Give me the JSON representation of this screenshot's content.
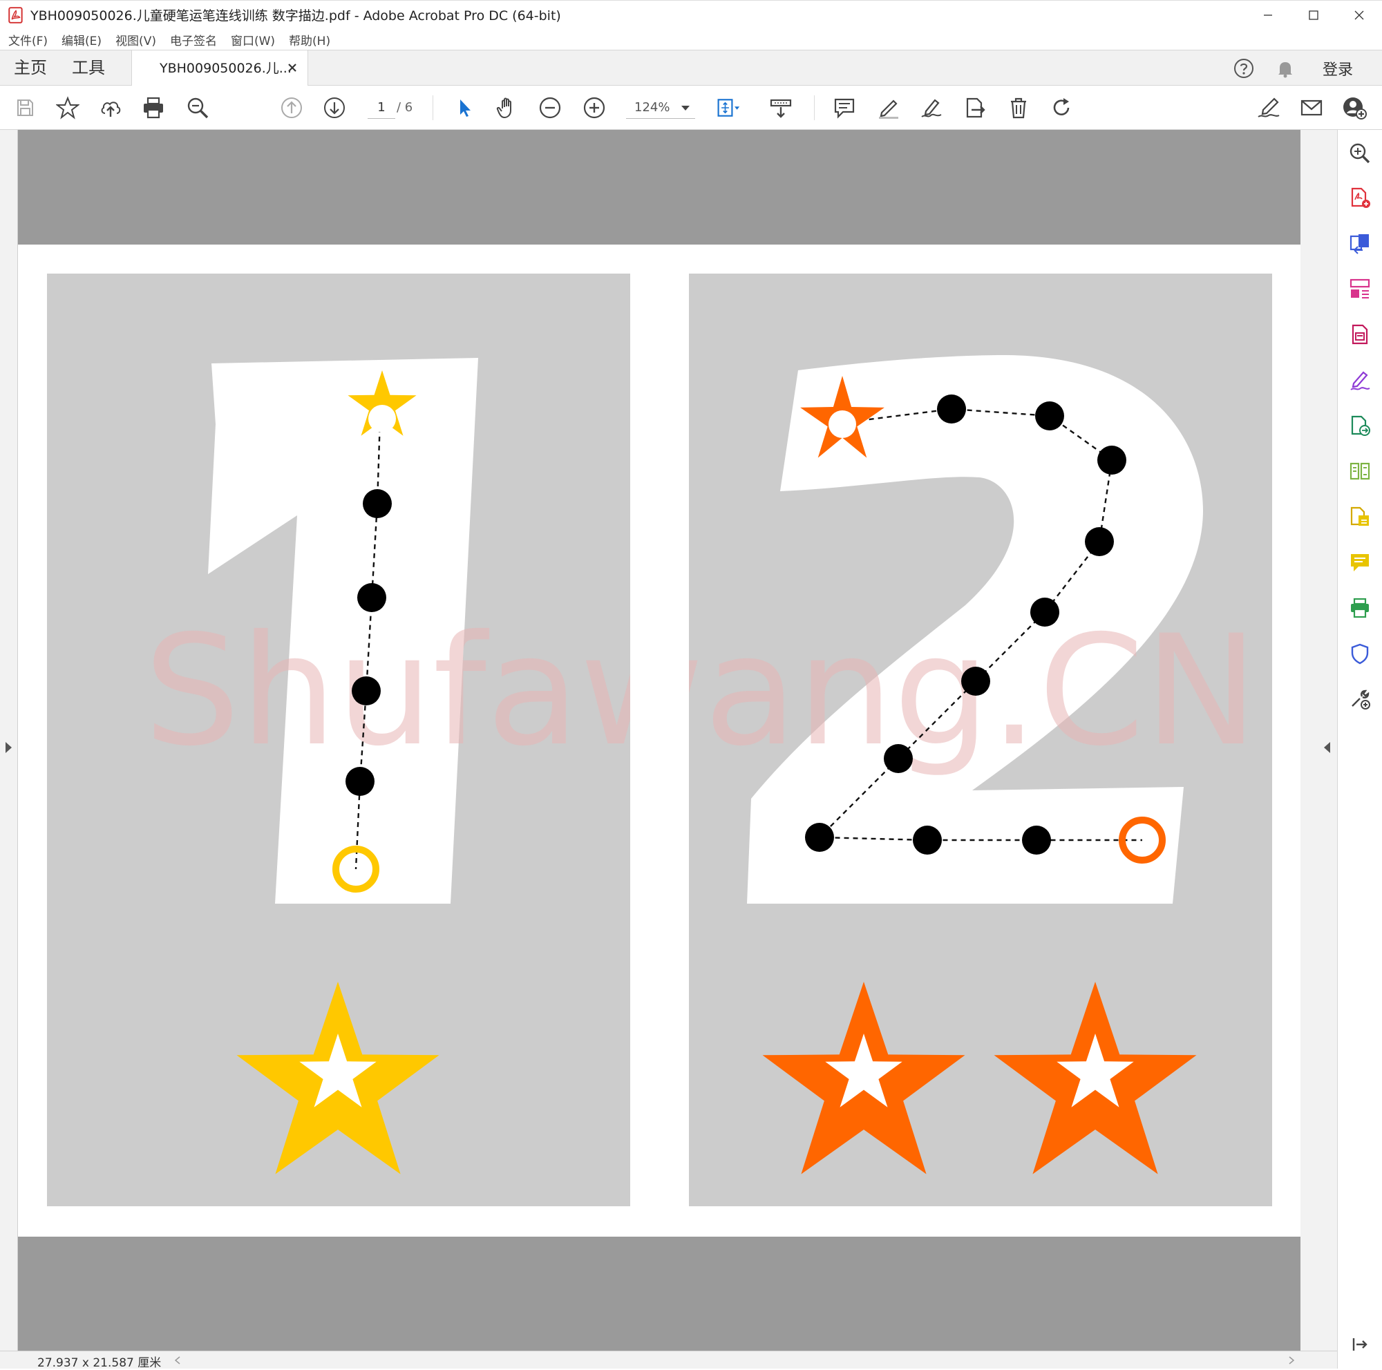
{
  "window": {
    "title": "YBH009050026.儿童硬笔运笔连线训练 数字描边.pdf - Adobe Acrobat Pro DC (64-bit)",
    "icons": [
      "pdf-app-icon",
      "minimize-icon",
      "maximize-icon",
      "close-icon"
    ]
  },
  "menubar": {
    "items": [
      "文件(F)",
      "编辑(E)",
      "视图(V)",
      "电子签名",
      "窗口(W)",
      "帮助(H)"
    ]
  },
  "tabs": {
    "home": "主页",
    "tools": "工具",
    "document": "YBH009050026.儿...",
    "login": "登录",
    "icons": [
      "help-icon",
      "bell-icon",
      "tab-close-icon"
    ]
  },
  "toolbar": {
    "current_page": "1",
    "page_total": "/ 6",
    "zoom": "124%",
    "icons": [
      "save-icon",
      "bookmark-star-icon",
      "upload-cloud-icon",
      "print-icon",
      "zoom-search-icon",
      "page-up-icon",
      "page-down-icon",
      "select-arrow-icon",
      "hand-icon",
      "zoom-out-icon",
      "zoom-in-icon",
      "fit-page-icon",
      "scroll-mode-icon",
      "comment-icon",
      "highlight-pen-icon",
      "sign-pen-icon",
      "share-file-icon",
      "delete-icon",
      "rotate-icon",
      "fill-sign-icon",
      "email-icon",
      "share-user-icon"
    ]
  },
  "document": {
    "watermark": "Shufawang.CN",
    "left_digit": "1",
    "right_digit": "2",
    "left_star_count": 1,
    "right_star_count": 2,
    "colors": {
      "yellow": "#FFC800",
      "orange": "#FF6600",
      "panel": "#CCCCCC",
      "watermark": "#E8B4B4",
      "page_bg": "#9A9A9A"
    }
  },
  "toolpane": {
    "icons": [
      "zoom-tool-icon",
      "create-pdf-icon",
      "export-pdf-icon",
      "organize-pages-icon",
      "edit-pdf-icon",
      "fill-sign-tool-icon",
      "send-for-review-icon",
      "compare-icon",
      "combine-files-icon",
      "comment-tool-icon",
      "print-production-icon",
      "protect-icon",
      "more-tools-icon",
      "expand-pane-icon"
    ]
  },
  "statusbar": {
    "dimensions": "27.937 x 21.587 厘米"
  }
}
